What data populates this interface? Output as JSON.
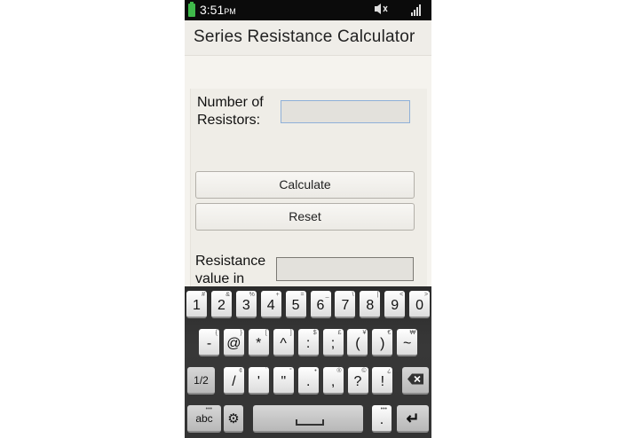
{
  "status_bar": {
    "time": "3:51",
    "ampm": "PM"
  },
  "app": {
    "title": "Series Resistance Calculator"
  },
  "form": {
    "num_resistors_label_line1": "Number of",
    "num_resistors_label_line2": "Resistors:",
    "num_resistors_value": "",
    "calculate_label": "Calculate",
    "reset_label": "Reset",
    "resistance_label_line1": "Resistance",
    "resistance_label_line2": "value in"
  },
  "keyboard": {
    "row1": [
      {
        "main": "1",
        "sub": "#"
      },
      {
        "main": "2",
        "sub": "&"
      },
      {
        "main": "3",
        "sub": "%"
      },
      {
        "main": "4",
        "sub": "+"
      },
      {
        "main": "5",
        "sub": "="
      },
      {
        "main": "6",
        "sub": "_"
      },
      {
        "main": "7",
        "sub": "\\"
      },
      {
        "main": "8",
        "sub": "|"
      },
      {
        "main": "9",
        "sub": "<"
      },
      {
        "main": "0",
        "sub": ">"
      }
    ],
    "row2": [
      {
        "main": "-",
        "sub": "{"
      },
      {
        "main": "@",
        "sub": "}"
      },
      {
        "main": "*",
        "sub": "["
      },
      {
        "main": "^",
        "sub": "]"
      },
      {
        "main": ":",
        "sub": "$"
      },
      {
        "main": ";",
        "sub": "£"
      },
      {
        "main": "(",
        "sub": "¥"
      },
      {
        "main": ")",
        "sub": "€"
      },
      {
        "main": "~",
        "sub": "₩"
      }
    ],
    "row3": [
      {
        "main": "/",
        "sub": "¢"
      },
      {
        "main": "'",
        "sub": "`"
      },
      {
        "main": "\"",
        "sub": "°"
      },
      {
        "main": ".",
        "sub": "•"
      },
      {
        "main": ",",
        "sub": "®"
      },
      {
        "main": "?",
        "sub": "©"
      },
      {
        "main": "!",
        "sub": "¿"
      }
    ],
    "shift_label": "1/2",
    "abc_label": "abc",
    "period_label": "."
  }
}
